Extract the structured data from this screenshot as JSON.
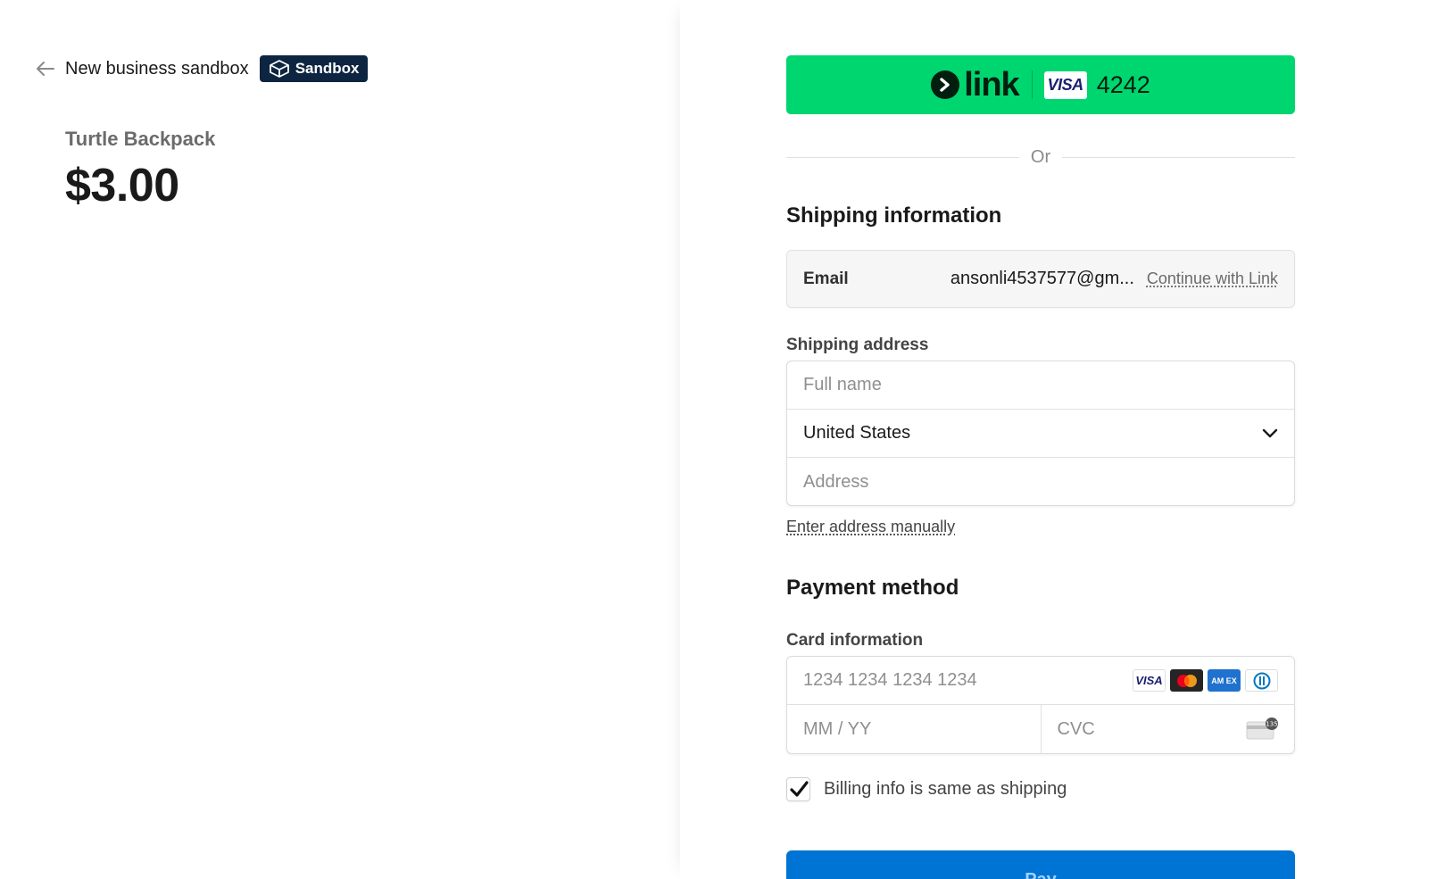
{
  "header": {
    "business_name": "New business sandbox",
    "sandbox_badge": "Sandbox"
  },
  "product": {
    "name": "Turtle Backpack",
    "price": "$3.00"
  },
  "link_button": {
    "brand": "link",
    "card_brand": "VISA",
    "last4": "4242",
    "color": "#00d66f"
  },
  "divider": {
    "or_text": "Or"
  },
  "shipping": {
    "title": "Shipping information",
    "email_label": "Email",
    "email_value": "ansonli4537577@gm...",
    "continue_link": "Continue with Link",
    "address_label": "Shipping address",
    "full_name_placeholder": "Full name",
    "country_value": "United States",
    "address_placeholder": "Address",
    "enter_manually": "Enter address manually"
  },
  "payment": {
    "title": "Payment method",
    "card_label": "Card information",
    "card_number_placeholder": "1234 1234 1234 1234",
    "expiry_placeholder": "MM / YY",
    "cvc_placeholder": "CVC",
    "card_brands": [
      "visa-icon",
      "mastercard-icon",
      "amex-icon",
      "diners-icon"
    ],
    "amex_text": "AM EX",
    "cvc_badge": "135"
  },
  "billing": {
    "same_as_shipping_label": "Billing info is same as shipping",
    "checked": true
  },
  "pay_button": {
    "label": "Pay",
    "color": "#0074d4"
  }
}
